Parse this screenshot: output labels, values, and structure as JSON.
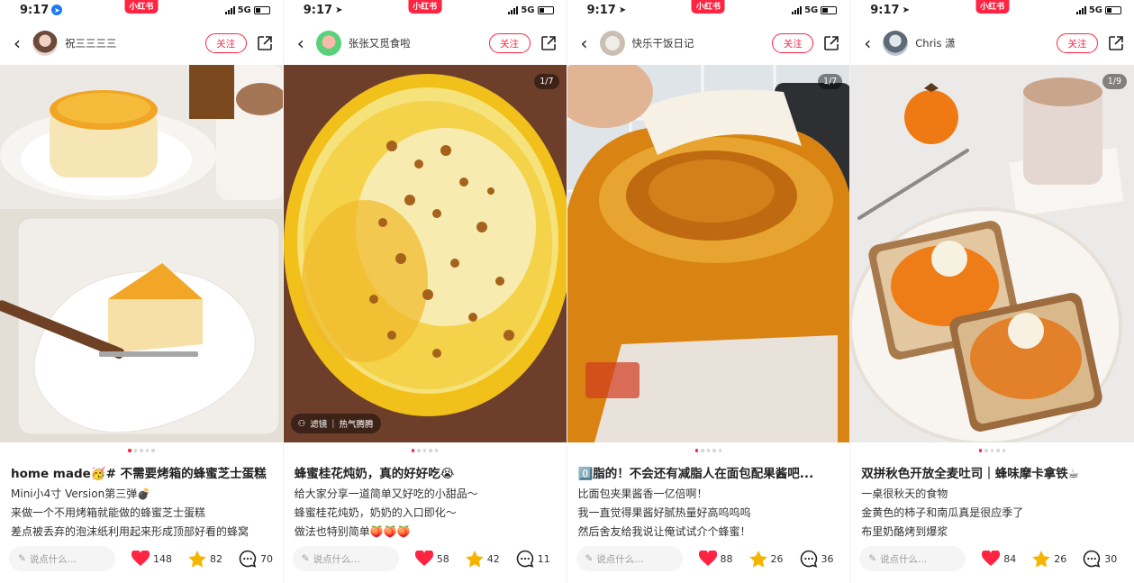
{
  "posts": [
    {
      "status": {
        "time": "9:17",
        "network": "5G"
      },
      "brand": "小红书",
      "author": "祝三三三三",
      "follow_label": "关注",
      "image_counter": "",
      "filter_tag": "",
      "filter_name": "",
      "title": "home made🥳# 不需要烤箱的蜂蜜芝士蛋糕",
      "body": [
        "Mini小4寸 Version第三弹💣",
        "来做一个不用烤箱就能做的蜂蜜芝士蛋糕",
        "差点被丢弃的泡沫纸利用起来形成顶部好看的蜂窝"
      ],
      "comment_placeholder": "说点什么...",
      "likes": "148",
      "stars": "82",
      "comments": "70"
    },
    {
      "status": {
        "time": "9:17",
        "network": "5G"
      },
      "brand": "小红书",
      "author": "张张又觅食啦",
      "follow_label": "关注",
      "image_counter": "1/7",
      "filter_tag": "滤镜",
      "filter_name": "热气腾腾",
      "title": "蜂蜜桂花炖奶，真的好好吃😭",
      "body": [
        "给大家分享一道简单又好吃的小甜品～",
        "蜂蜜桂花炖奶，奶奶的入口即化～",
        "做法也特别简单🍑🍑🍑"
      ],
      "comment_placeholder": "说点什么...",
      "likes": "58",
      "stars": "42",
      "comments": "11"
    },
    {
      "status": {
        "time": "9:17",
        "network": "5G"
      },
      "brand": "小红书",
      "author": "快乐干饭日记",
      "follow_label": "关注",
      "image_counter": "1/7",
      "filter_tag": "",
      "filter_name": "",
      "title": "0️⃣脂的！不会还有减脂人在面包配果酱吧...",
      "body": [
        "比面包夹果酱香一亿倍啊！",
        "我一直觉得果酱好腻热量好高呜呜呜",
        "然后舍友给我说让俺试试介个蜂蜜！"
      ],
      "comment_placeholder": "说点什么...",
      "likes": "88",
      "stars": "26",
      "comments": "36"
    },
    {
      "status": {
        "time": "9:17",
        "network": "5G"
      },
      "brand": "小红书",
      "author": "Chris 潇",
      "follow_label": "关注",
      "image_counter": "1/9",
      "filter_tag": "",
      "filter_name": "",
      "title": "双拼秋色开放全麦吐司｜蜂味摩卡拿铁☕",
      "body": [
        "一桌很秋天的食物",
        "金黄色的柿子和南瓜真是很应季了",
        "布里奶酪烤到爆浆"
      ],
      "comment_placeholder": "说点什么...",
      "likes": "84",
      "stars": "26",
      "comments": "30"
    }
  ],
  "colors": {
    "accent": "#ff2442",
    "heart": "#ff2442",
    "star": "#f5b400"
  },
  "icons": [
    "back-arrow-icon",
    "share-icon",
    "location-arrow-icon",
    "signal-icon",
    "battery-icon",
    "pencil-icon",
    "heart-icon",
    "star-icon",
    "comment-icon",
    "filter-icon"
  ]
}
